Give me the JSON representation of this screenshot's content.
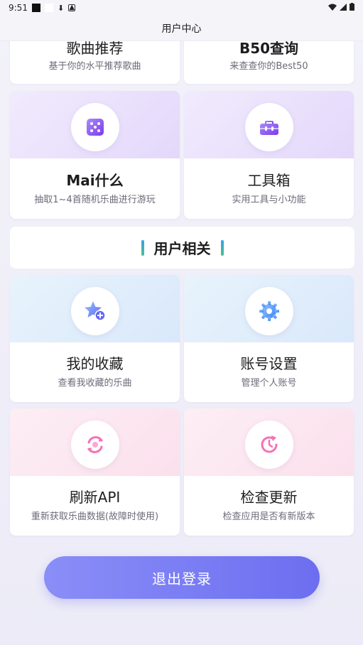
{
  "status_bar": {
    "time": "9:51"
  },
  "header": {
    "title": "用户中心"
  },
  "cards_top_partial": [
    {
      "title": "歌曲推荐",
      "subtitle": "基于你的水平推荐歌曲"
    },
    {
      "title": "B50查询",
      "subtitle": "来查查你的Best50"
    }
  ],
  "cards_tools": [
    {
      "title": "Mai什么",
      "subtitle": "抽取1~4首随机乐曲进行游玩",
      "icon": "dice-icon"
    },
    {
      "title": "工具箱",
      "subtitle": "实用工具与小功能",
      "icon": "toolbox-icon"
    }
  ],
  "section": {
    "title": "用户相关"
  },
  "cards_user": [
    {
      "title": "我的收藏",
      "subtitle": "查看我收藏的乐曲",
      "icon": "star-add-icon"
    },
    {
      "title": "账号设置",
      "subtitle": "管理个人账号",
      "icon": "gear-icon"
    },
    {
      "title": "刷新API",
      "subtitle": "重新获取乐曲数据(故障时使用)",
      "icon": "refresh-icon"
    },
    {
      "title": "检查更新",
      "subtitle": "检查应用是否有新版本",
      "icon": "update-icon"
    }
  ],
  "logout": {
    "label": "退出登录"
  },
  "colors": {
    "accent_start": "#8a8ef7",
    "accent_end": "#6c6ef0",
    "purple_icon": "#8b5cf6",
    "blue_icon": "#3b82f6",
    "pink_icon": "#f472b6"
  }
}
